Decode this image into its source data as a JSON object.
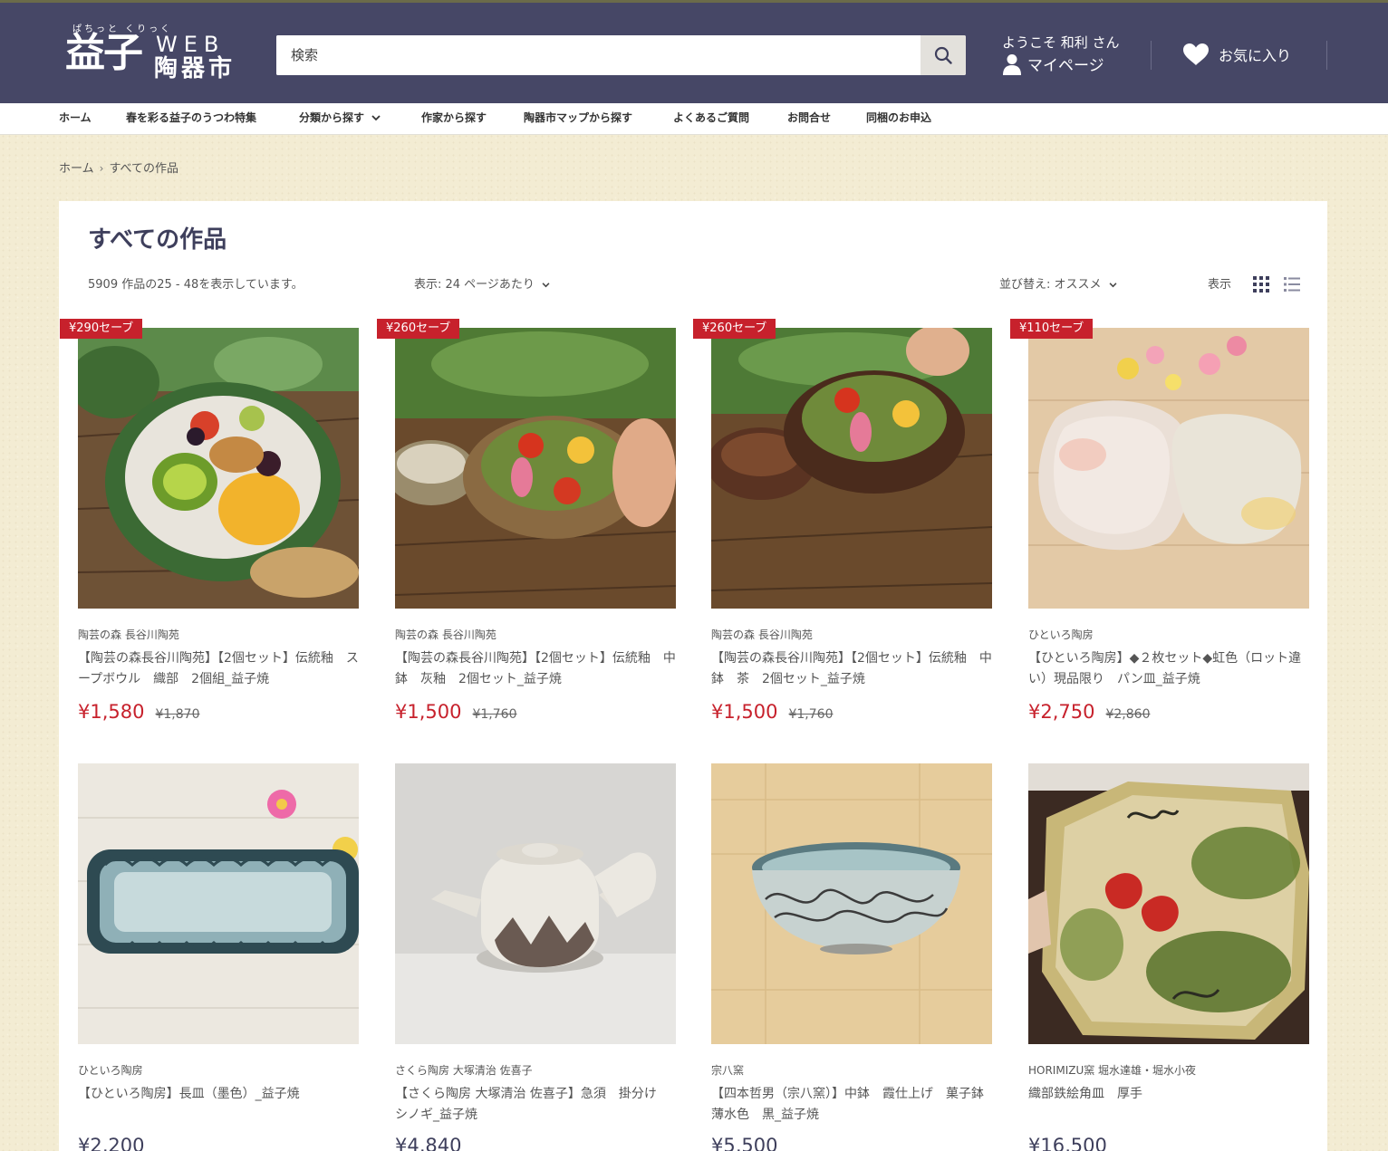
{
  "header": {
    "logo": {
      "ruby": "ぱちっと くりっく",
      "main": "益子",
      "web": "WEB",
      "sub": "陶器市"
    },
    "search": {
      "placeholder": "検索"
    },
    "account": {
      "welcome": "ようこそ 和利 さん",
      "mypage": "マイページ"
    },
    "favorites": "お気に入り"
  },
  "nav": {
    "items": [
      {
        "label": "ホーム"
      },
      {
        "label": "春を彩る益子のうつわ特集"
      },
      {
        "label": "分類から探す"
      },
      {
        "label": "作家から探す"
      },
      {
        "label": "陶器市マップから探す"
      },
      {
        "label": "よくあるご質問"
      },
      {
        "label": "お問合せ"
      },
      {
        "label": "同梱のお申込"
      }
    ]
  },
  "breadcrumb": {
    "home": "ホーム",
    "current": "すべての作品"
  },
  "collection": {
    "title": "すべての作品",
    "count_text": "5909 作品の25 - 48を表示しています。",
    "per_page": "表示: 24 ページあたり",
    "sort": "並び替え: オススメ",
    "view_label": "表示"
  },
  "products": [
    {
      "badge": "¥290セーブ",
      "vendor": "陶芸の森 長谷川陶苑",
      "title": "【陶芸の森長谷川陶苑】【2個セット】伝統釉　スープボウル　織部　2個組_益子焼",
      "price": "¥1,580",
      "compare_price": "¥1,870"
    },
    {
      "badge": "¥260セーブ",
      "vendor": "陶芸の森 長谷川陶苑",
      "title": "【陶芸の森長谷川陶苑】【2個セット】伝統釉　中鉢　灰釉　2個セット_益子焼",
      "price": "¥1,500",
      "compare_price": "¥1,760"
    },
    {
      "badge": "¥260セーブ",
      "vendor": "陶芸の森 長谷川陶苑",
      "title": "【陶芸の森長谷川陶苑】【2個セット】伝統釉　中鉢　茶　2個セット_益子焼",
      "price": "¥1,500",
      "compare_price": "¥1,760"
    },
    {
      "badge": "¥110セーブ",
      "vendor": "ひといろ陶房",
      "title": "【ひといろ陶房】◆２枚セット◆虹色（ロット違い）現品限り　パン皿_益子焼",
      "price": "¥2,750",
      "compare_price": "¥2,860"
    },
    {
      "vendor": "ひといろ陶房",
      "title": "【ひといろ陶房】長皿（墨色）_益子焼",
      "price": "¥2,200"
    },
    {
      "vendor": "さくら陶房 大塚清治 佐喜子",
      "title": "【さくら陶房 大塚清治 佐喜子】急須　掛分け　シノギ_益子焼",
      "price": "¥4,840"
    },
    {
      "vendor": "宗八窯",
      "title": "【四本哲男（宗八窯）】中鉢　霞仕上げ　菓子鉢　薄水色　黒_益子焼",
      "price": "¥5,500"
    },
    {
      "vendor": "HORIMIZU窯 堀水達雄・堀水小夜",
      "title": "織部鉄絵角皿　厚手",
      "price": "¥16,500"
    }
  ],
  "colors": {
    "header_bg": "#464766",
    "sale_red": "#c7212c",
    "title_navy": "#3e3f5c",
    "page_bg": "#f3ecd3"
  },
  "icons": [
    "search-icon",
    "person-icon",
    "heart-icon",
    "chevron-down-icon",
    "grid-view-icon",
    "list-view-icon"
  ]
}
